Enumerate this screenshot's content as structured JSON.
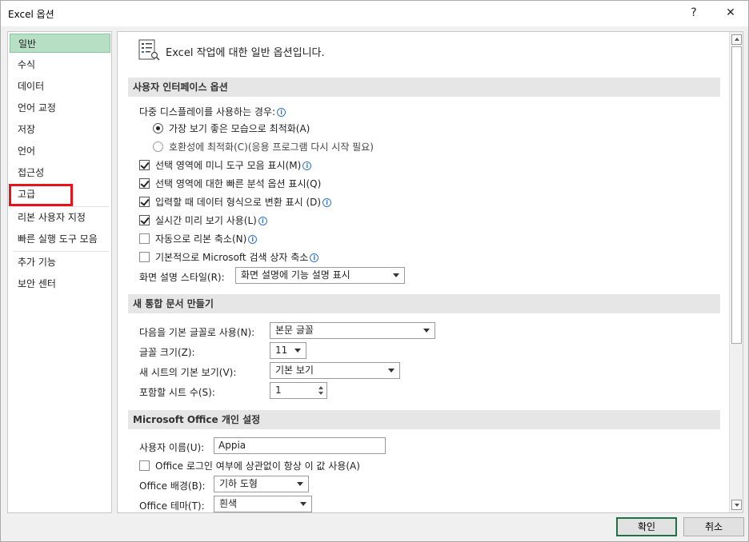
{
  "window": {
    "title": "Excel 옵션",
    "help_label": "?",
    "close_label": "✕"
  },
  "sidebar": {
    "items": [
      {
        "label": "일반"
      },
      {
        "label": "수식"
      },
      {
        "label": "데이터"
      },
      {
        "label": "언어 교정"
      },
      {
        "label": "저장"
      },
      {
        "label": "언어"
      },
      {
        "label": "접근성"
      },
      {
        "label": "고급"
      },
      {
        "label": "리본 사용자 지정"
      },
      {
        "label": "빠른 실행 도구 모음"
      },
      {
        "label": "추가 기능"
      },
      {
        "label": "보안 센터"
      }
    ],
    "selected_index": 0,
    "highlight_color": "#e8121b"
  },
  "main": {
    "heading": "Excel 작업에 대한 일반 옵션입니다.",
    "ui_section": {
      "title": "사용자 인터페이스 옵션",
      "multi_display_label": "다중 디스플레이를 사용하는 경우:",
      "radio_best_appearance": "가장 보기 좋은 모습으로 최적화(A)",
      "radio_compat": "호환성에 최적화(C)(응용 프로그램 다시 시작 필요)",
      "chk_mini_toolbar": "선택 영역에 미니 도구 모음 표시(M)",
      "chk_quick_analysis": "선택 영역에 대한 빠른 분석 옵션 표시(Q)",
      "chk_data_convert": "입력할 때 데이터 형식으로 변환 표시 (D)",
      "chk_live_preview": "실시간 미리 보기 사용(L)",
      "chk_collapse_ribbon": "자동으로 리본 축소(N)",
      "chk_search_box": "기본적으로 Microsoft 검색 상자 축소",
      "screentip_label": "화면 설명 스타일(R):",
      "screentip_value": "화면 설명에 기능 설명 표시"
    },
    "workbook_section": {
      "title": "새 통합 문서 만들기",
      "font_label": "다음을 기본 글꼴로 사용(N):",
      "font_value": "본문 글꼴",
      "size_label": "글꼴 크기(Z):",
      "size_value": "11",
      "view_label": "새 시트의 기본 보기(V):",
      "view_value": "기본 보기",
      "sheets_label": "포함할 시트 수(S):",
      "sheets_value": "1"
    },
    "office_section": {
      "title": "Microsoft Office 개인 설정",
      "username_label": "사용자 이름(U):",
      "username_value": "Appia",
      "chk_always_use": "Office 로그인 여부에 상관없이 항상 이 값 사용(A)",
      "background_label": "Office 배경(B):",
      "background_value": "기하 도형",
      "theme_label": "Office 테마(T):",
      "theme_value": "흰색"
    }
  },
  "footer": {
    "ok_label": "확인",
    "cancel_label": "취소"
  },
  "colors": {
    "accent": "#1e7145",
    "selected_bg": "#b7dfc4",
    "info": "#2e75c8"
  }
}
